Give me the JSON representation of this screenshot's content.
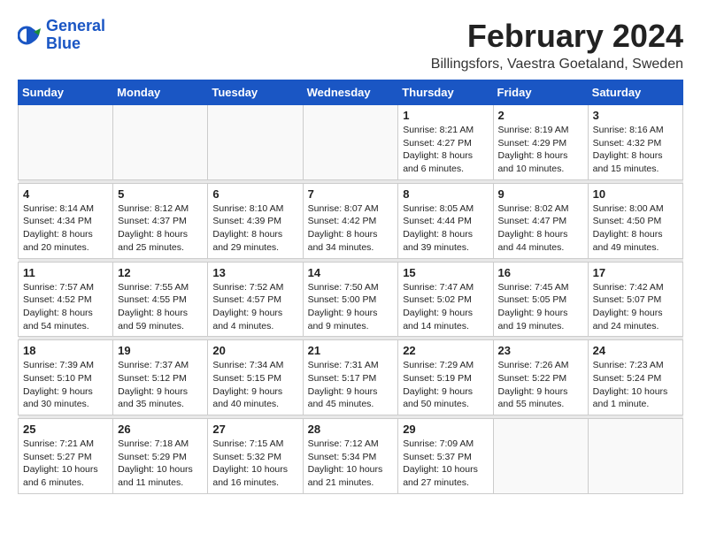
{
  "header": {
    "month_year": "February 2024",
    "location": "Billingsfors, Vaestra Goetaland, Sweden"
  },
  "logo": {
    "line1": "General",
    "line2": "Blue"
  },
  "days_of_week": [
    "Sunday",
    "Monday",
    "Tuesday",
    "Wednesday",
    "Thursday",
    "Friday",
    "Saturday"
  ],
  "weeks": [
    [
      {
        "day": "",
        "info": ""
      },
      {
        "day": "",
        "info": ""
      },
      {
        "day": "",
        "info": ""
      },
      {
        "day": "",
        "info": ""
      },
      {
        "day": "1",
        "info": "Sunrise: 8:21 AM\nSunset: 4:27 PM\nDaylight: 8 hours\nand 6 minutes."
      },
      {
        "day": "2",
        "info": "Sunrise: 8:19 AM\nSunset: 4:29 PM\nDaylight: 8 hours\nand 10 minutes."
      },
      {
        "day": "3",
        "info": "Sunrise: 8:16 AM\nSunset: 4:32 PM\nDaylight: 8 hours\nand 15 minutes."
      }
    ],
    [
      {
        "day": "4",
        "info": "Sunrise: 8:14 AM\nSunset: 4:34 PM\nDaylight: 8 hours\nand 20 minutes."
      },
      {
        "day": "5",
        "info": "Sunrise: 8:12 AM\nSunset: 4:37 PM\nDaylight: 8 hours\nand 25 minutes."
      },
      {
        "day": "6",
        "info": "Sunrise: 8:10 AM\nSunset: 4:39 PM\nDaylight: 8 hours\nand 29 minutes."
      },
      {
        "day": "7",
        "info": "Sunrise: 8:07 AM\nSunset: 4:42 PM\nDaylight: 8 hours\nand 34 minutes."
      },
      {
        "day": "8",
        "info": "Sunrise: 8:05 AM\nSunset: 4:44 PM\nDaylight: 8 hours\nand 39 minutes."
      },
      {
        "day": "9",
        "info": "Sunrise: 8:02 AM\nSunset: 4:47 PM\nDaylight: 8 hours\nand 44 minutes."
      },
      {
        "day": "10",
        "info": "Sunrise: 8:00 AM\nSunset: 4:50 PM\nDaylight: 8 hours\nand 49 minutes."
      }
    ],
    [
      {
        "day": "11",
        "info": "Sunrise: 7:57 AM\nSunset: 4:52 PM\nDaylight: 8 hours\nand 54 minutes."
      },
      {
        "day": "12",
        "info": "Sunrise: 7:55 AM\nSunset: 4:55 PM\nDaylight: 8 hours\nand 59 minutes."
      },
      {
        "day": "13",
        "info": "Sunrise: 7:52 AM\nSunset: 4:57 PM\nDaylight: 9 hours\nand 4 minutes."
      },
      {
        "day": "14",
        "info": "Sunrise: 7:50 AM\nSunset: 5:00 PM\nDaylight: 9 hours\nand 9 minutes."
      },
      {
        "day": "15",
        "info": "Sunrise: 7:47 AM\nSunset: 5:02 PM\nDaylight: 9 hours\nand 14 minutes."
      },
      {
        "day": "16",
        "info": "Sunrise: 7:45 AM\nSunset: 5:05 PM\nDaylight: 9 hours\nand 19 minutes."
      },
      {
        "day": "17",
        "info": "Sunrise: 7:42 AM\nSunset: 5:07 PM\nDaylight: 9 hours\nand 24 minutes."
      }
    ],
    [
      {
        "day": "18",
        "info": "Sunrise: 7:39 AM\nSunset: 5:10 PM\nDaylight: 9 hours\nand 30 minutes."
      },
      {
        "day": "19",
        "info": "Sunrise: 7:37 AM\nSunset: 5:12 PM\nDaylight: 9 hours\nand 35 minutes."
      },
      {
        "day": "20",
        "info": "Sunrise: 7:34 AM\nSunset: 5:15 PM\nDaylight: 9 hours\nand 40 minutes."
      },
      {
        "day": "21",
        "info": "Sunrise: 7:31 AM\nSunset: 5:17 PM\nDaylight: 9 hours\nand 45 minutes."
      },
      {
        "day": "22",
        "info": "Sunrise: 7:29 AM\nSunset: 5:19 PM\nDaylight: 9 hours\nand 50 minutes."
      },
      {
        "day": "23",
        "info": "Sunrise: 7:26 AM\nSunset: 5:22 PM\nDaylight: 9 hours\nand 55 minutes."
      },
      {
        "day": "24",
        "info": "Sunrise: 7:23 AM\nSunset: 5:24 PM\nDaylight: 10 hours\nand 1 minute."
      }
    ],
    [
      {
        "day": "25",
        "info": "Sunrise: 7:21 AM\nSunset: 5:27 PM\nDaylight: 10 hours\nand 6 minutes."
      },
      {
        "day": "26",
        "info": "Sunrise: 7:18 AM\nSunset: 5:29 PM\nDaylight: 10 hours\nand 11 minutes."
      },
      {
        "day": "27",
        "info": "Sunrise: 7:15 AM\nSunset: 5:32 PM\nDaylight: 10 hours\nand 16 minutes."
      },
      {
        "day": "28",
        "info": "Sunrise: 7:12 AM\nSunset: 5:34 PM\nDaylight: 10 hours\nand 21 minutes."
      },
      {
        "day": "29",
        "info": "Sunrise: 7:09 AM\nSunset: 5:37 PM\nDaylight: 10 hours\nand 27 minutes."
      },
      {
        "day": "",
        "info": ""
      },
      {
        "day": "",
        "info": ""
      }
    ]
  ]
}
